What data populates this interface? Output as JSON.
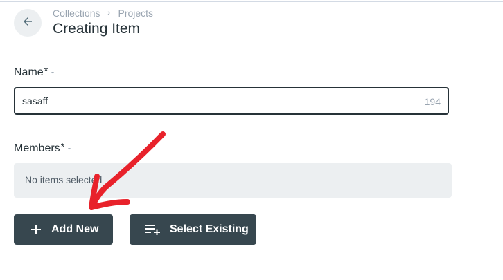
{
  "breadcrumb": {
    "items": [
      "Collections",
      "Projects"
    ]
  },
  "page": {
    "title": "Creating Item"
  },
  "name_field": {
    "label": "Name",
    "required_mark": "*",
    "value": "sasaff",
    "counter": "194"
  },
  "members_field": {
    "label": "Members",
    "required_mark": "*",
    "empty_text": "No items selected"
  },
  "actions": {
    "add_new_label": "Add New",
    "select_existing_label": "Select Existing"
  },
  "colors": {
    "button_bg": "#37474f",
    "field_bg": "#eceff1",
    "muted_text": "#9aa5b1",
    "annotation_arrow": "#e8222b"
  },
  "icons": {
    "back": "arrow-left-icon",
    "breadcrumb_separator": "chevron-right-icon",
    "field_menu": "caret-down-icon",
    "add": "plus-icon",
    "select": "playlist-add-icon"
  }
}
